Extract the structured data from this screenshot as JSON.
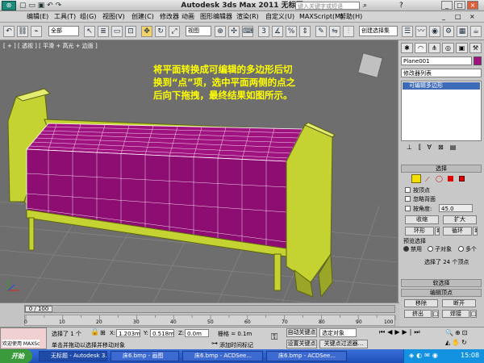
{
  "window": {
    "title": "Autodesk 3ds Max  2011        无标题",
    "search_placeholder": "键入关键字或短语"
  },
  "menubar": {
    "items": [
      "编辑(E)",
      "工具(T)",
      "组(G)",
      "视图(V)",
      "创建(C)",
      "修改器",
      "动画",
      "图形编辑器",
      "渲染(R)",
      "自定义(U)",
      "MAXScript(M)",
      "帮助(H)"
    ]
  },
  "toolbar": {
    "filter_dropdown": "全部",
    "view_dropdown": "视图",
    "named_selection": "创建选择集"
  },
  "viewport": {
    "label": "[ + ] [ 透视 ] [ 平滑 + 高光 + 边面 ]",
    "annotation_lines": [
      "将平面转换成可编辑的多边形后切",
      "换到“点”项，选中平面两侧的点之",
      "后向下拖拽，最终结果如图所示。"
    ]
  },
  "panel": {
    "object_name": "Plane001",
    "modifier_list": "修改器列表",
    "stack_item": "可编辑多边形",
    "selection_title": "选择",
    "by_vertex": "按顶点",
    "ignore_backfacing": "忽略背面",
    "by_angle": "按角度:",
    "angle_value": "45.0",
    "shrink": "收缩",
    "grow": "扩大",
    "ring": "环形",
    "loop": "循环",
    "preview_selection": "预览选择",
    "disabled": "禁用",
    "sub_object": "子对象",
    "multi": "多个",
    "selected_info": "选择了 24 个顶点",
    "soft_selection": "软选择",
    "edit_vertices": "编辑顶点",
    "remove": "移除",
    "break": "断开",
    "extrude": "挤出",
    "weld": "焊接"
  },
  "timeline": {
    "frame_range": "0 / 100",
    "ticks": [
      "0",
      "10",
      "20",
      "30",
      "40",
      "50",
      "60",
      "70",
      "80",
      "90",
      "100"
    ]
  },
  "status": {
    "welcome": "欢迎使用 MAXSc",
    "selected": "选择了 1 个",
    "hint": "单击并拖动以选择并移动对象",
    "x_label": "X:",
    "x_value": "1.203m",
    "y_label": "Y:",
    "y_value": "0.518m",
    "z_label": "Z:",
    "z_value": "0.0m",
    "grid": "栅格 = 0.1m",
    "add_time_tag": "添加时间标记",
    "auto_key": "自动关键点",
    "set_key": "设置关键点",
    "selected_object": "选定对象",
    "key_filters": "关键点过滤器..."
  },
  "taskbar": {
    "start": "开始",
    "tasks": [
      "无标题 - Autodesk 3...",
      "床6.bmp - 画图",
      "床6.bmp - ACDSee...",
      "床6.bmp - ACDSee..."
    ],
    "clock": "15:08"
  },
  "colors": {
    "mattress": "#a0127f",
    "frame": "#c5d332",
    "annotation": "#ffff00",
    "viewport_bg": "#6e6e6e"
  }
}
